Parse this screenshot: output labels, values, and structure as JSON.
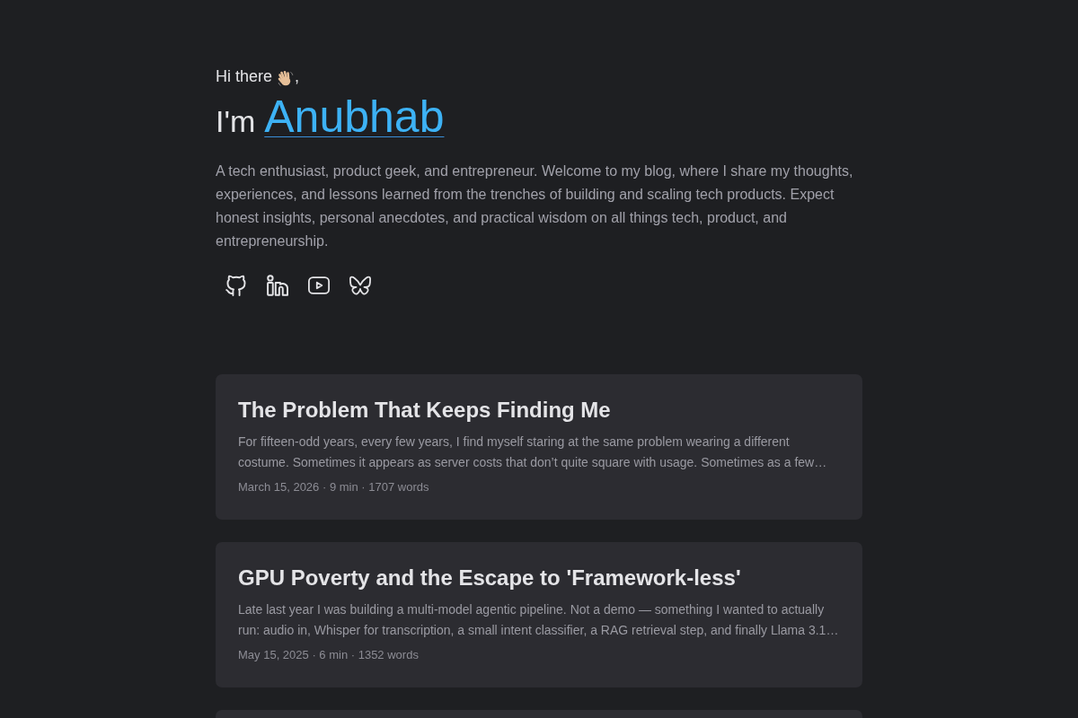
{
  "intro": {
    "greeting": "Hi there",
    "greeting_end": ",",
    "heading_prefix": "I'm",
    "name": "Anubhab",
    "description": "A tech enthusiast, product geek, and entrepreneur. Welcome to my blog, where I share my thoughts, experiences, and lessons learned from the trenches of building and scaling tech products. Expect honest insights, personal anecdotes, and practical wisdom on all things tech, product, and entrepreneurship."
  },
  "social_links": [
    {
      "kind": "github"
    },
    {
      "kind": "linkedin"
    },
    {
      "kind": "youtube"
    },
    {
      "kind": "butterfly"
    }
  ],
  "posts": [
    {
      "title": "The Problem That Keeps Finding Me",
      "excerpt": "For fifteen-odd years, every few years, I find myself staring at the same problem wearing a different costume. Sometimes it appears as server costs that don’t quite square with usage. Sometimes as a few…",
      "meta": "March 15, 2026 · 9 min · 1707 words"
    },
    {
      "title": "GPU Poverty and the Escape to 'Framework-less'",
      "excerpt": "Late last year I was building a multi-model agentic pipeline. Not a demo — something I wanted to actually run: audio in, Whisper for transcription, a small intent classifier, a RAG retrieval step, and finally Llama 3.1…",
      "meta": "May 15, 2025 · 6 min · 1352 words"
    }
  ]
}
